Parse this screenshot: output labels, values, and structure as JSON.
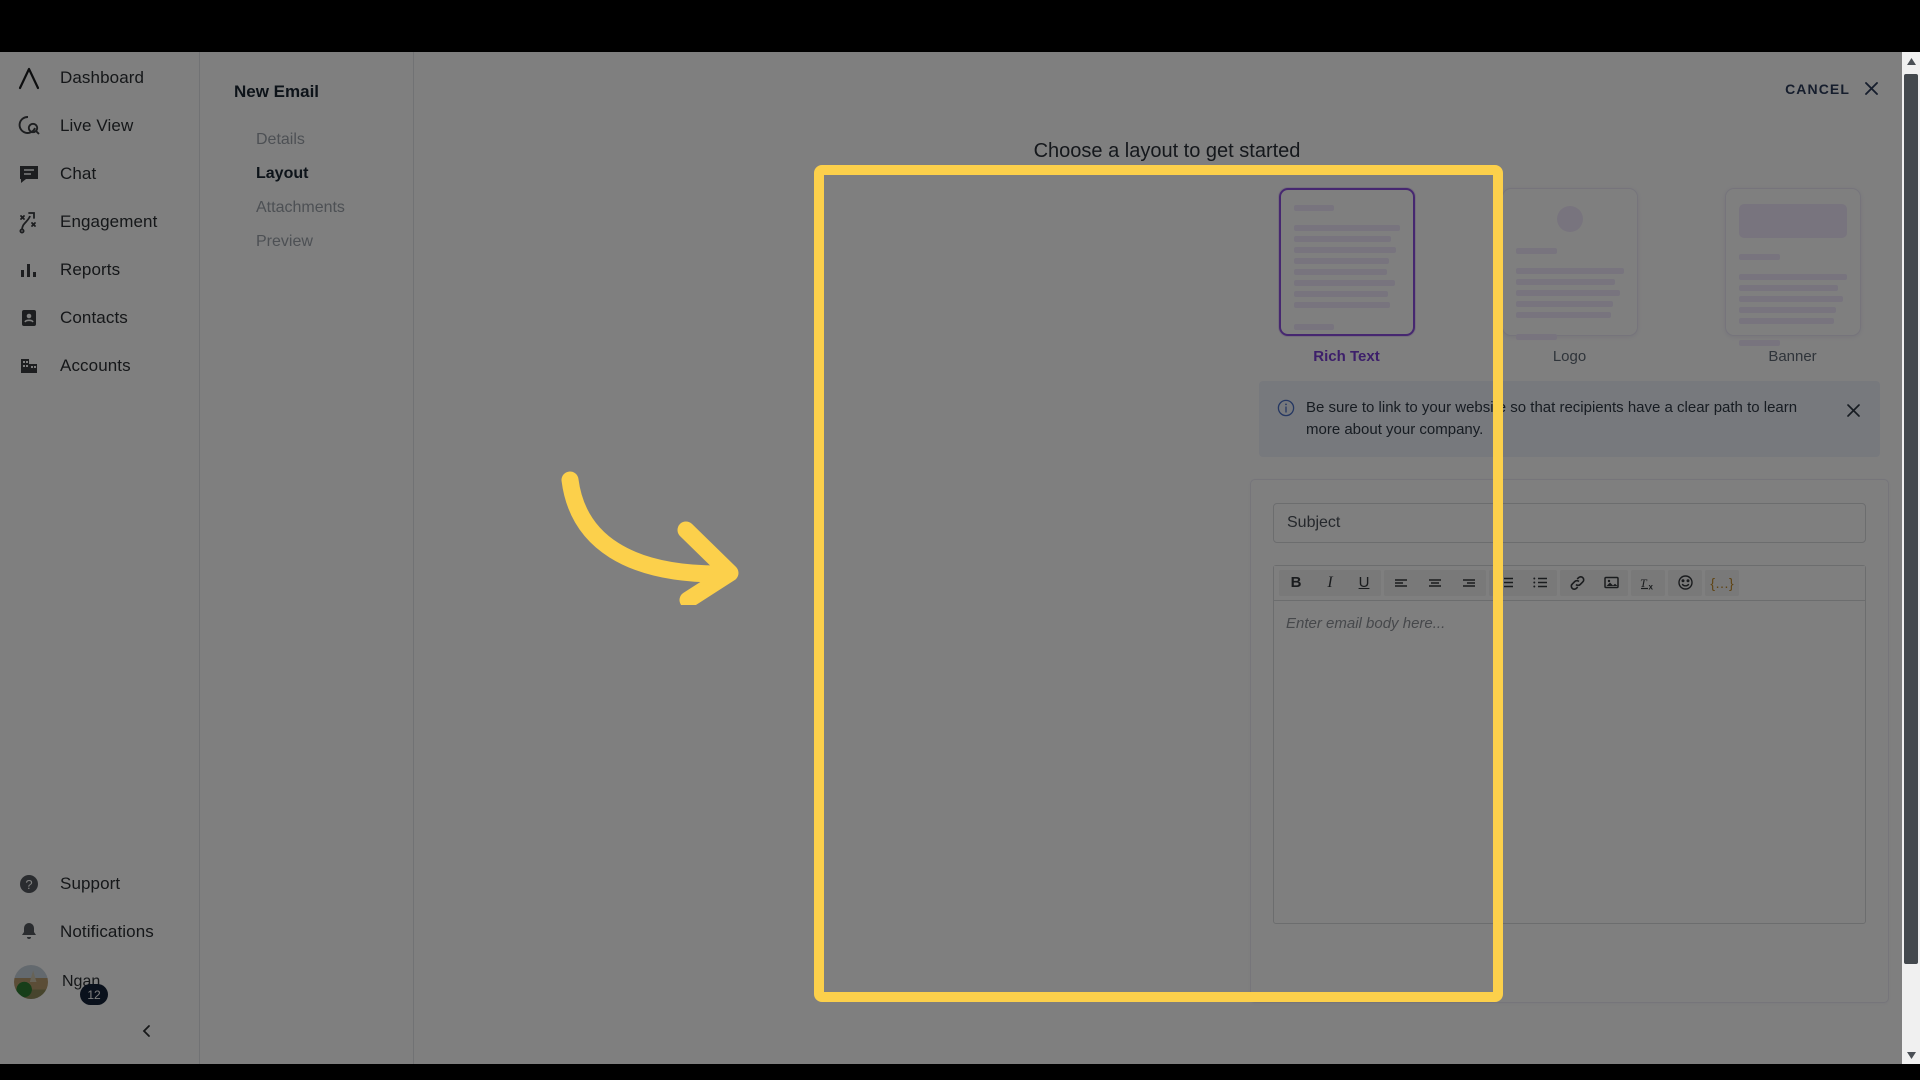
{
  "sidebar": {
    "brand_icon": "peak-logo-icon",
    "items": [
      {
        "label": "Dashboard",
        "icon": "peak-logo-icon"
      },
      {
        "label": "Live View",
        "icon": "live-view-icon"
      },
      {
        "label": "Chat",
        "icon": "chat-icon"
      },
      {
        "label": "Engagement",
        "icon": "engagement-icon"
      },
      {
        "label": "Reports",
        "icon": "reports-bar-chart-icon"
      },
      {
        "label": "Contacts",
        "icon": "contacts-card-icon"
      },
      {
        "label": "Accounts",
        "icon": "accounts-building-icon"
      }
    ],
    "bottom_items": [
      {
        "label": "Support",
        "icon": "help-circle-icon"
      },
      {
        "label": "Notifications",
        "icon": "bell-icon"
      }
    ],
    "user": {
      "name": "Ngan",
      "badge_count": "12",
      "avatar_icon": "user-avatar-photo",
      "cursor_icon": "g-cursor-icon"
    },
    "collapse_icon": "chevron-left-icon"
  },
  "steps": {
    "title": "New Email",
    "items": [
      {
        "label": "Details",
        "active": false
      },
      {
        "label": "Layout",
        "active": true
      },
      {
        "label": "Attachments",
        "active": false
      },
      {
        "label": "Preview",
        "active": false
      }
    ]
  },
  "canvas": {
    "title": "Choose a layout to get started",
    "cancel_label": "CANCEL",
    "cancel_icon": "close-x-icon"
  },
  "layouts": [
    {
      "label": "Rich Text",
      "kind": "rich-text",
      "selected": true
    },
    {
      "label": "Logo",
      "kind": "logo",
      "selected": false
    },
    {
      "label": "Banner",
      "kind": "banner",
      "selected": false
    }
  ],
  "info_banner": {
    "icon": "info-circle-icon",
    "text": "Be sure to link to your website so that recipients have a clear path to learn more about your company.",
    "close_icon": "close-x-icon"
  },
  "editor": {
    "subject_placeholder": "Subject",
    "subject_value": "",
    "body_placeholder": "Enter email body here...",
    "toolbar": [
      {
        "name": "bold-button",
        "glyph": "B",
        "style": "bold"
      },
      {
        "name": "italic-button",
        "glyph": "I",
        "style": "italic"
      },
      {
        "name": "underline-button",
        "glyph": "U",
        "style": "under"
      },
      {
        "name": "align-left-button",
        "glyph": "",
        "style": "icon"
      },
      {
        "name": "align-center-button",
        "glyph": "",
        "style": "icon"
      },
      {
        "name": "align-right-button",
        "glyph": "",
        "style": "icon"
      },
      {
        "name": "ordered-list-button",
        "glyph": "",
        "style": "icon"
      },
      {
        "name": "bullet-list-button",
        "glyph": "",
        "style": "icon"
      },
      {
        "name": "insert-link-button",
        "glyph": "",
        "style": "icon"
      },
      {
        "name": "insert-image-button",
        "glyph": "",
        "style": "icon"
      },
      {
        "name": "clear-formatting-button",
        "glyph": "",
        "style": "icon"
      },
      {
        "name": "emoji-button",
        "glyph": "",
        "style": "icon"
      },
      {
        "name": "merge-tag-button",
        "glyph": "{…}",
        "style": "merge"
      }
    ]
  },
  "annotation": {
    "highlight_color": "#fcd04b",
    "arrow_icon": "curved-arrow-right-icon"
  },
  "colors": {
    "accent_purple": "#7b3fd4",
    "highlight_yellow": "#fcd04b",
    "info_blue": "#4a6fc4",
    "navy": "#2d3c5b"
  }
}
